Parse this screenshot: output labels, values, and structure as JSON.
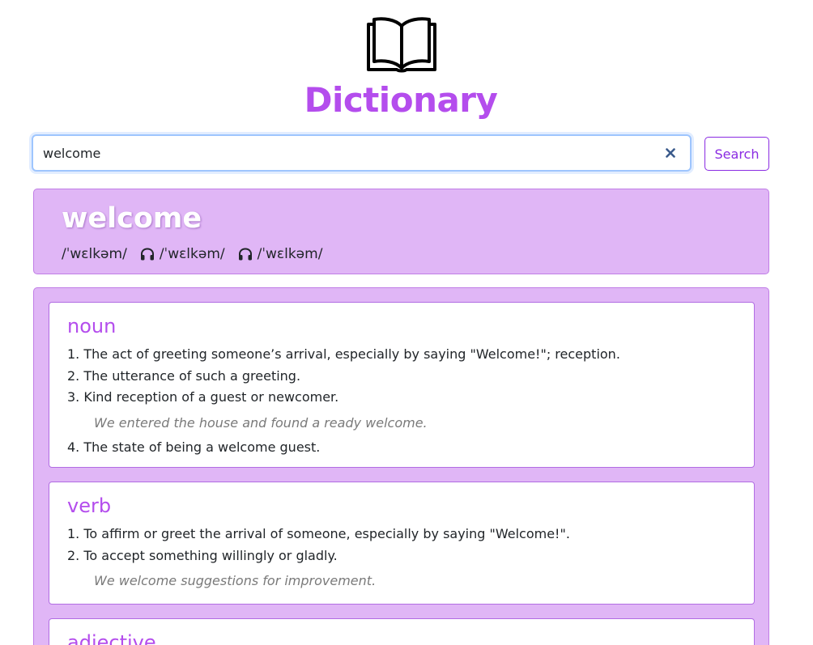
{
  "app": {
    "title": "Dictionary"
  },
  "search": {
    "value": "welcome",
    "button_label": "Search"
  },
  "word": {
    "text": "welcome",
    "phonetics": [
      "/ˈwɛlkəm/",
      "/ˈwɛlkəm/",
      "/ˈwɛlkəm/"
    ]
  },
  "meanings": [
    {
      "part_of_speech": "noun",
      "definitions": [
        {
          "text": "1. The act of greeting someone’s arrival, especially by saying \"Welcome!\"; reception."
        },
        {
          "text": "2. The utterance of such a greeting."
        },
        {
          "text": "3. Kind reception of a guest or newcomer.",
          "example": "We entered the house and found a ready welcome."
        },
        {
          "text": "4. The state of being a welcome guest."
        }
      ]
    },
    {
      "part_of_speech": "verb",
      "definitions": [
        {
          "text": "1. To affirm or greet the arrival of someone, especially by saying \"Welcome!\"."
        },
        {
          "text": "2. To accept something willingly or gladly.",
          "example": "We welcome suggestions for improvement."
        }
      ]
    },
    {
      "part_of_speech": "adjective",
      "definitions": []
    }
  ],
  "colors": {
    "accent": "#b44ded",
    "card_bg": "#e0b6f6",
    "button": "#8a2be2"
  },
  "icons": [
    "book-icon",
    "close-icon",
    "headphones-icon"
  ]
}
